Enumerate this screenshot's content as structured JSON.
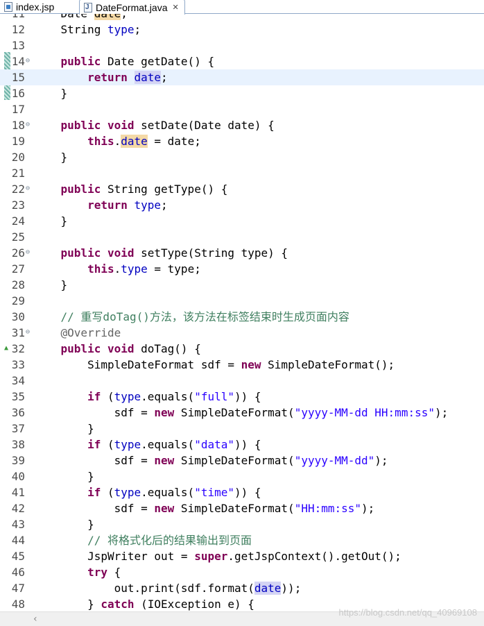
{
  "tabs": [
    {
      "label": "index.jsp",
      "icon": "jsp-file-icon",
      "active": false
    },
    {
      "label": "DateFormat.java",
      "icon": "java-file-icon",
      "active": true
    }
  ],
  "lines": [
    {
      "n": "11",
      "html": "    Date <span class=\"occ\">date</span>;"
    },
    {
      "n": "12",
      "html": "    String <span class=\"fld\">type</span>;"
    },
    {
      "n": "13",
      "html": ""
    },
    {
      "n": "14",
      "fold": true,
      "html": "    <span class=\"kw\">public</span> Date getDate() {"
    },
    {
      "n": "15",
      "current": true,
      "html": "        <span class=\"kw\">return</span> <span class=\"fld occr\">date</span>;"
    },
    {
      "n": "16",
      "html": "    }"
    },
    {
      "n": "17",
      "html": ""
    },
    {
      "n": "18",
      "fold": true,
      "html": "    <span class=\"kw\">public</span> <span class=\"kw\">void</span> setDate(Date date) {"
    },
    {
      "n": "19",
      "html": "        <span class=\"kw\">this</span>.<span class=\"fld occ\">date</span> = date;"
    },
    {
      "n": "20",
      "html": "    }"
    },
    {
      "n": "21",
      "html": ""
    },
    {
      "n": "22",
      "fold": true,
      "html": "    <span class=\"kw\">public</span> String getType() {"
    },
    {
      "n": "23",
      "html": "        <span class=\"kw\">return</span> <span class=\"fld\">type</span>;"
    },
    {
      "n": "24",
      "html": "    }"
    },
    {
      "n": "25",
      "html": ""
    },
    {
      "n": "26",
      "fold": true,
      "html": "    <span class=\"kw\">public</span> <span class=\"kw\">void</span> setType(String type) {"
    },
    {
      "n": "27",
      "html": "        <span class=\"kw\">this</span>.<span class=\"fld\">type</span> = type;"
    },
    {
      "n": "28",
      "html": "    }"
    },
    {
      "n": "29",
      "html": ""
    },
    {
      "n": "30",
      "html": "    <span class=\"cm\">// 重写doTag()方法，该方法在标签结束时生成页面内容</span>"
    },
    {
      "n": "31",
      "fold": true,
      "html": "    <span class=\"an\">@Override</span>"
    },
    {
      "n": "32",
      "override": true,
      "html": "    <span class=\"kw\">public</span> <span class=\"kw\">void</span> doTag() {"
    },
    {
      "n": "33",
      "html": "        SimpleDateFormat sdf = <span class=\"kw\">new</span> SimpleDateFormat();"
    },
    {
      "n": "34",
      "html": ""
    },
    {
      "n": "35",
      "html": "        <span class=\"kw\">if</span> (<span class=\"fld\">type</span>.equals(<span class=\"str\">\"full\"</span>)) {"
    },
    {
      "n": "36",
      "html": "            sdf = <span class=\"kw\">new</span> SimpleDateFormat(<span class=\"str\">\"yyyy-MM-dd HH:mm:ss\"</span>);"
    },
    {
      "n": "37",
      "html": "        }"
    },
    {
      "n": "38",
      "html": "        <span class=\"kw\">if</span> (<span class=\"fld\">type</span>.equals(<span class=\"str\">\"data\"</span>)) {"
    },
    {
      "n": "39",
      "html": "            sdf = <span class=\"kw\">new</span> SimpleDateFormat(<span class=\"str\">\"yyyy-MM-dd\"</span>);"
    },
    {
      "n": "40",
      "html": "        }"
    },
    {
      "n": "41",
      "html": "        <span class=\"kw\">if</span> (<span class=\"fld\">type</span>.equals(<span class=\"str\">\"time\"</span>)) {"
    },
    {
      "n": "42",
      "html": "            sdf = <span class=\"kw\">new</span> SimpleDateFormat(<span class=\"str\">\"HH:mm:ss\"</span>);"
    },
    {
      "n": "43",
      "html": "        }"
    },
    {
      "n": "44",
      "html": "        <span class=\"cm\">// 将格式化后的结果输出到页面</span>"
    },
    {
      "n": "45",
      "html": "        JspWriter out = <span class=\"kw\">super</span>.getJspContext().getOut();"
    },
    {
      "n": "46",
      "html": "        <span class=\"kw\">try</span> {"
    },
    {
      "n": "47",
      "html": "            out.print(sdf.format(<span class=\"fld occr\">date</span>));"
    },
    {
      "n": "48",
      "html": "        } <span class=\"kw\">catch</span> (IOException e) {"
    }
  ],
  "watermark": "https://blog.csdn.net/qq_40969108",
  "colors": {
    "keyword": "#7f0055",
    "field": "#0000c0",
    "string": "#2a00ff",
    "comment": "#3f7f5f",
    "current_line": "#e8f2fe"
  }
}
